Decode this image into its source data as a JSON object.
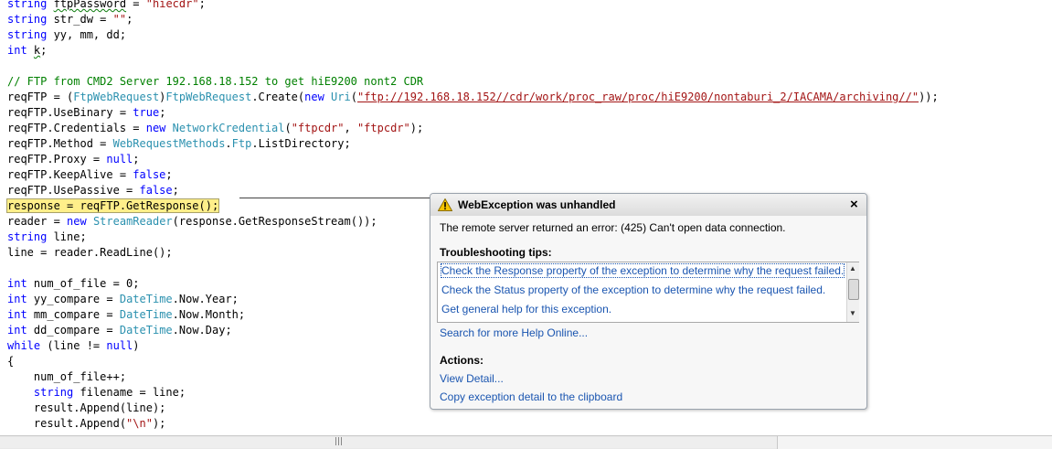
{
  "code": {
    "l1_type": "string",
    "l1_rest_a": " ",
    "l1_var": "ftpPassword",
    "l1_rest_b": " = ",
    "l1_str": "\"hiecdr\"",
    "l1_end": ";",
    "l2_type": "string",
    "l2_rest": " str_dw = ",
    "l2_str": "\"\"",
    "l2_end": ";",
    "l3_type": "string",
    "l3_rest": " yy, mm, dd;",
    "l4_type": "int",
    "l4_rest": " ",
    "l4_var": "k",
    "l4_end": ";",
    "l5_comment": "// FTP from CMD2 Server 192.168.18.152 to get hiE9200 nont2 CDR",
    "l6_a": "reqFTP = (",
    "l6_t1": "FtpWebRequest",
    "l6_b": ")",
    "l6_t2": "FtpWebRequest",
    "l6_c": ".Create(",
    "l6_kw": "new",
    "l6_d": " ",
    "l6_t3": "Uri",
    "l6_e": "(",
    "l6_url": "\"ftp://192.168.18.152//cdr/work/proc_raw/proc/hiE9200/nontaburi_2/IACAMA/archiving//\"",
    "l6_f": "));",
    "l7_a": "reqFTP.UseBinary = ",
    "l7_kw": "true",
    "l7_b": ";",
    "l8_a": "reqFTP.Credentials = ",
    "l8_kw": "new",
    "l8_b": " ",
    "l8_t": "NetworkCredential",
    "l8_c": "(",
    "l8_s1": "\"ftpcdr\"",
    "l8_d": ", ",
    "l8_s2": "\"ftpcdr\"",
    "l8_e": ");",
    "l9_a": "reqFTP.Method = ",
    "l9_t": "WebRequestMethods",
    "l9_b": ".",
    "l9_t2": "Ftp",
    "l9_c": ".ListDirectory;",
    "l10_a": "reqFTP.Proxy = ",
    "l10_kw": "null",
    "l10_b": ";",
    "l11_a": "reqFTP.KeepAlive = ",
    "l11_kw": "false",
    "l11_b": ";",
    "l12_a": "reqFTP.UsePassive = ",
    "l12_kw": "false",
    "l12_b": ";",
    "l13": "response = reqFTP.GetResponse();",
    "l14_a": "reader = ",
    "l14_kw": "new",
    "l14_b": " ",
    "l14_t": "StreamReader",
    "l14_c": "(response.GetResponseStream());",
    "l15_type": "string",
    "l15_rest": " line;",
    "l16": "line = reader.ReadLine();",
    "l17_type": "int",
    "l17_rest": " num_of_file = 0;",
    "l18_type": "int",
    "l18_a": " yy_compare = ",
    "l18_t": "DateTime",
    "l18_b": ".Now.Year;",
    "l19_type": "int",
    "l19_a": " mm_compare = ",
    "l19_t": "DateTime",
    "l19_b": ".Now.Month;",
    "l20_type": "int",
    "l20_a": " dd_compare = ",
    "l20_t": "DateTime",
    "l20_b": ".Now.Day;",
    "l21_kw": "while",
    "l21_a": " (line != ",
    "l21_kw2": "null",
    "l21_b": ")",
    "l22": "{",
    "l23": "    num_of_file++;",
    "l24_ind": "    ",
    "l24_type": "string",
    "l24_rest": " filename = line;",
    "l25": "    result.Append(line);",
    "l26_a": "    result.Append(",
    "l26_str": "\"\\n\"",
    "l26_b": ");"
  },
  "scrollbar": {
    "grip": "|||"
  },
  "dialog": {
    "title": "WebException was unhandled",
    "close": "×",
    "message": "The remote server returned an error: (425) Can't open data connection.",
    "tips_title": "Troubleshooting tips:",
    "tips": [
      "Check the Response property of the exception to determine why the request failed.",
      "Check the Status property of the exception to determine why the request failed.",
      "Get general help for this exception."
    ],
    "tips_scroll_up": "▲",
    "tips_scroll_down": "▼",
    "search_link": "Search for more Help Online...",
    "actions_title": "Actions:",
    "actions": [
      "View Detail...",
      "Copy exception detail to the clipboard"
    ],
    "accent_link_color": "#1a55b0",
    "highlight_color": "#ffef8a"
  }
}
